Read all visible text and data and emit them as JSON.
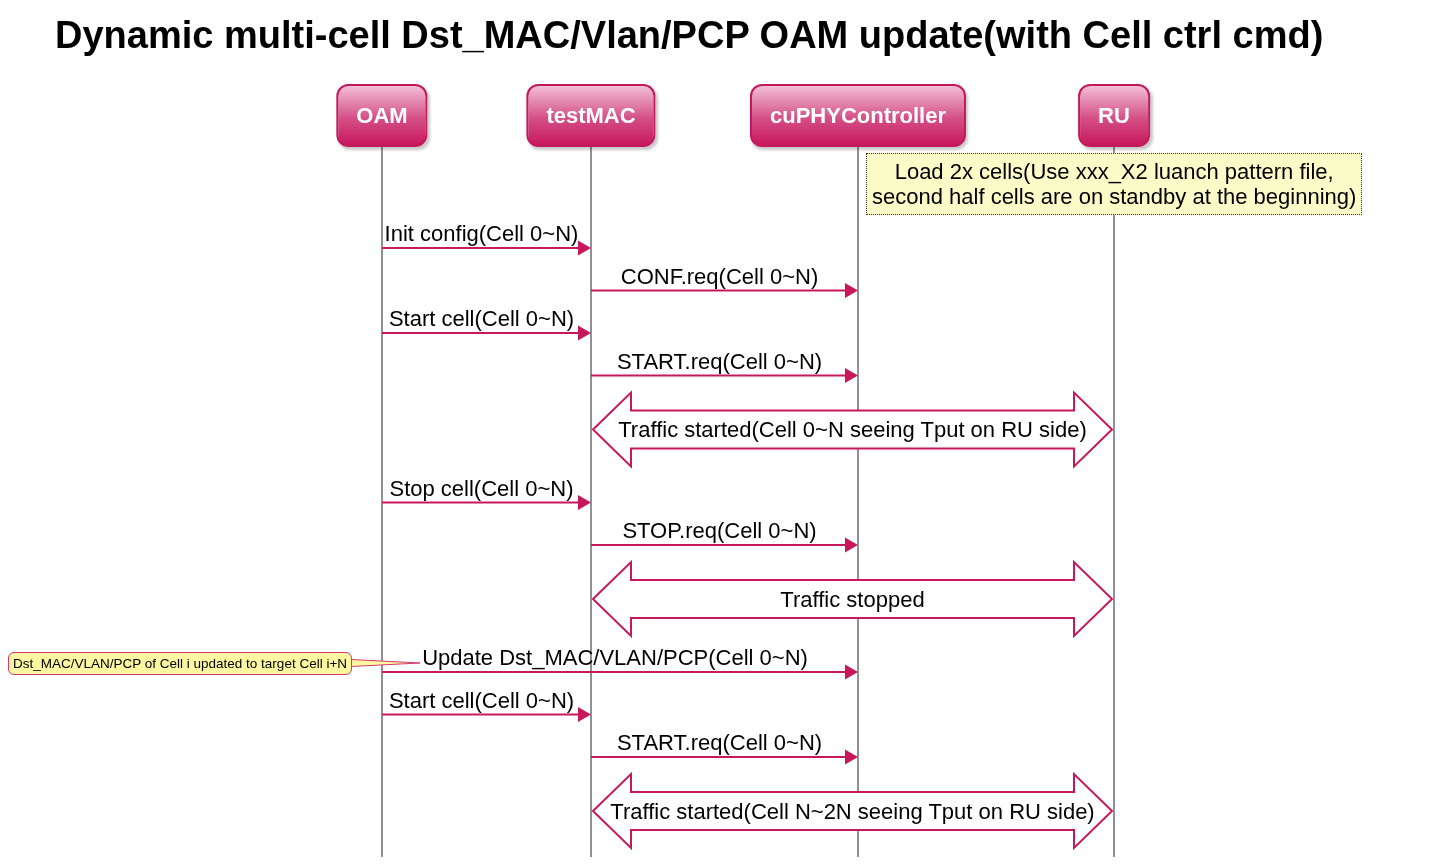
{
  "title": "Dynamic multi-cell Dst_MAC/Vlan/PCP OAM update(with Cell ctrl cmd)",
  "participants": [
    {
      "name": "OAM"
    },
    {
      "name": "testMAC"
    },
    {
      "name": "cuPHYController"
    },
    {
      "name": "RU"
    }
  ],
  "events": [
    {
      "kind": "note",
      "text": "Load 2x cells(Use xxx_X2 luanch pattern file,\nsecond half cells are on standby at the beginning)"
    },
    {
      "kind": "message",
      "label": "Init config(Cell 0~N)"
    },
    {
      "kind": "message",
      "label": "CONF.req(Cell 0~N)"
    },
    {
      "kind": "message",
      "label": "Start cell(Cell 0~N)"
    },
    {
      "kind": "message",
      "label": "START.req(Cell 0~N)"
    },
    {
      "kind": "span",
      "label": "Traffic started(Cell 0~N seeing Tput on RU side)"
    },
    {
      "kind": "message",
      "label": "Stop cell(Cell 0~N)"
    },
    {
      "kind": "message",
      "label": "STOP.req(Cell 0~N)"
    },
    {
      "kind": "span",
      "label": "Traffic stopped"
    },
    {
      "kind": "message",
      "label": "Update Dst_MAC/VLAN/PCP(Cell 0~N)",
      "callout": "Dst_MAC/VLAN/PCP of Cell i updated to target Cell i+N"
    },
    {
      "kind": "message",
      "label": "Start cell(Cell 0~N)"
    },
    {
      "kind": "message",
      "label": "START.req(Cell 0~N)"
    },
    {
      "kind": "span",
      "label": "Traffic started(Cell N~2N seeing Tput on RU side)"
    }
  ]
}
